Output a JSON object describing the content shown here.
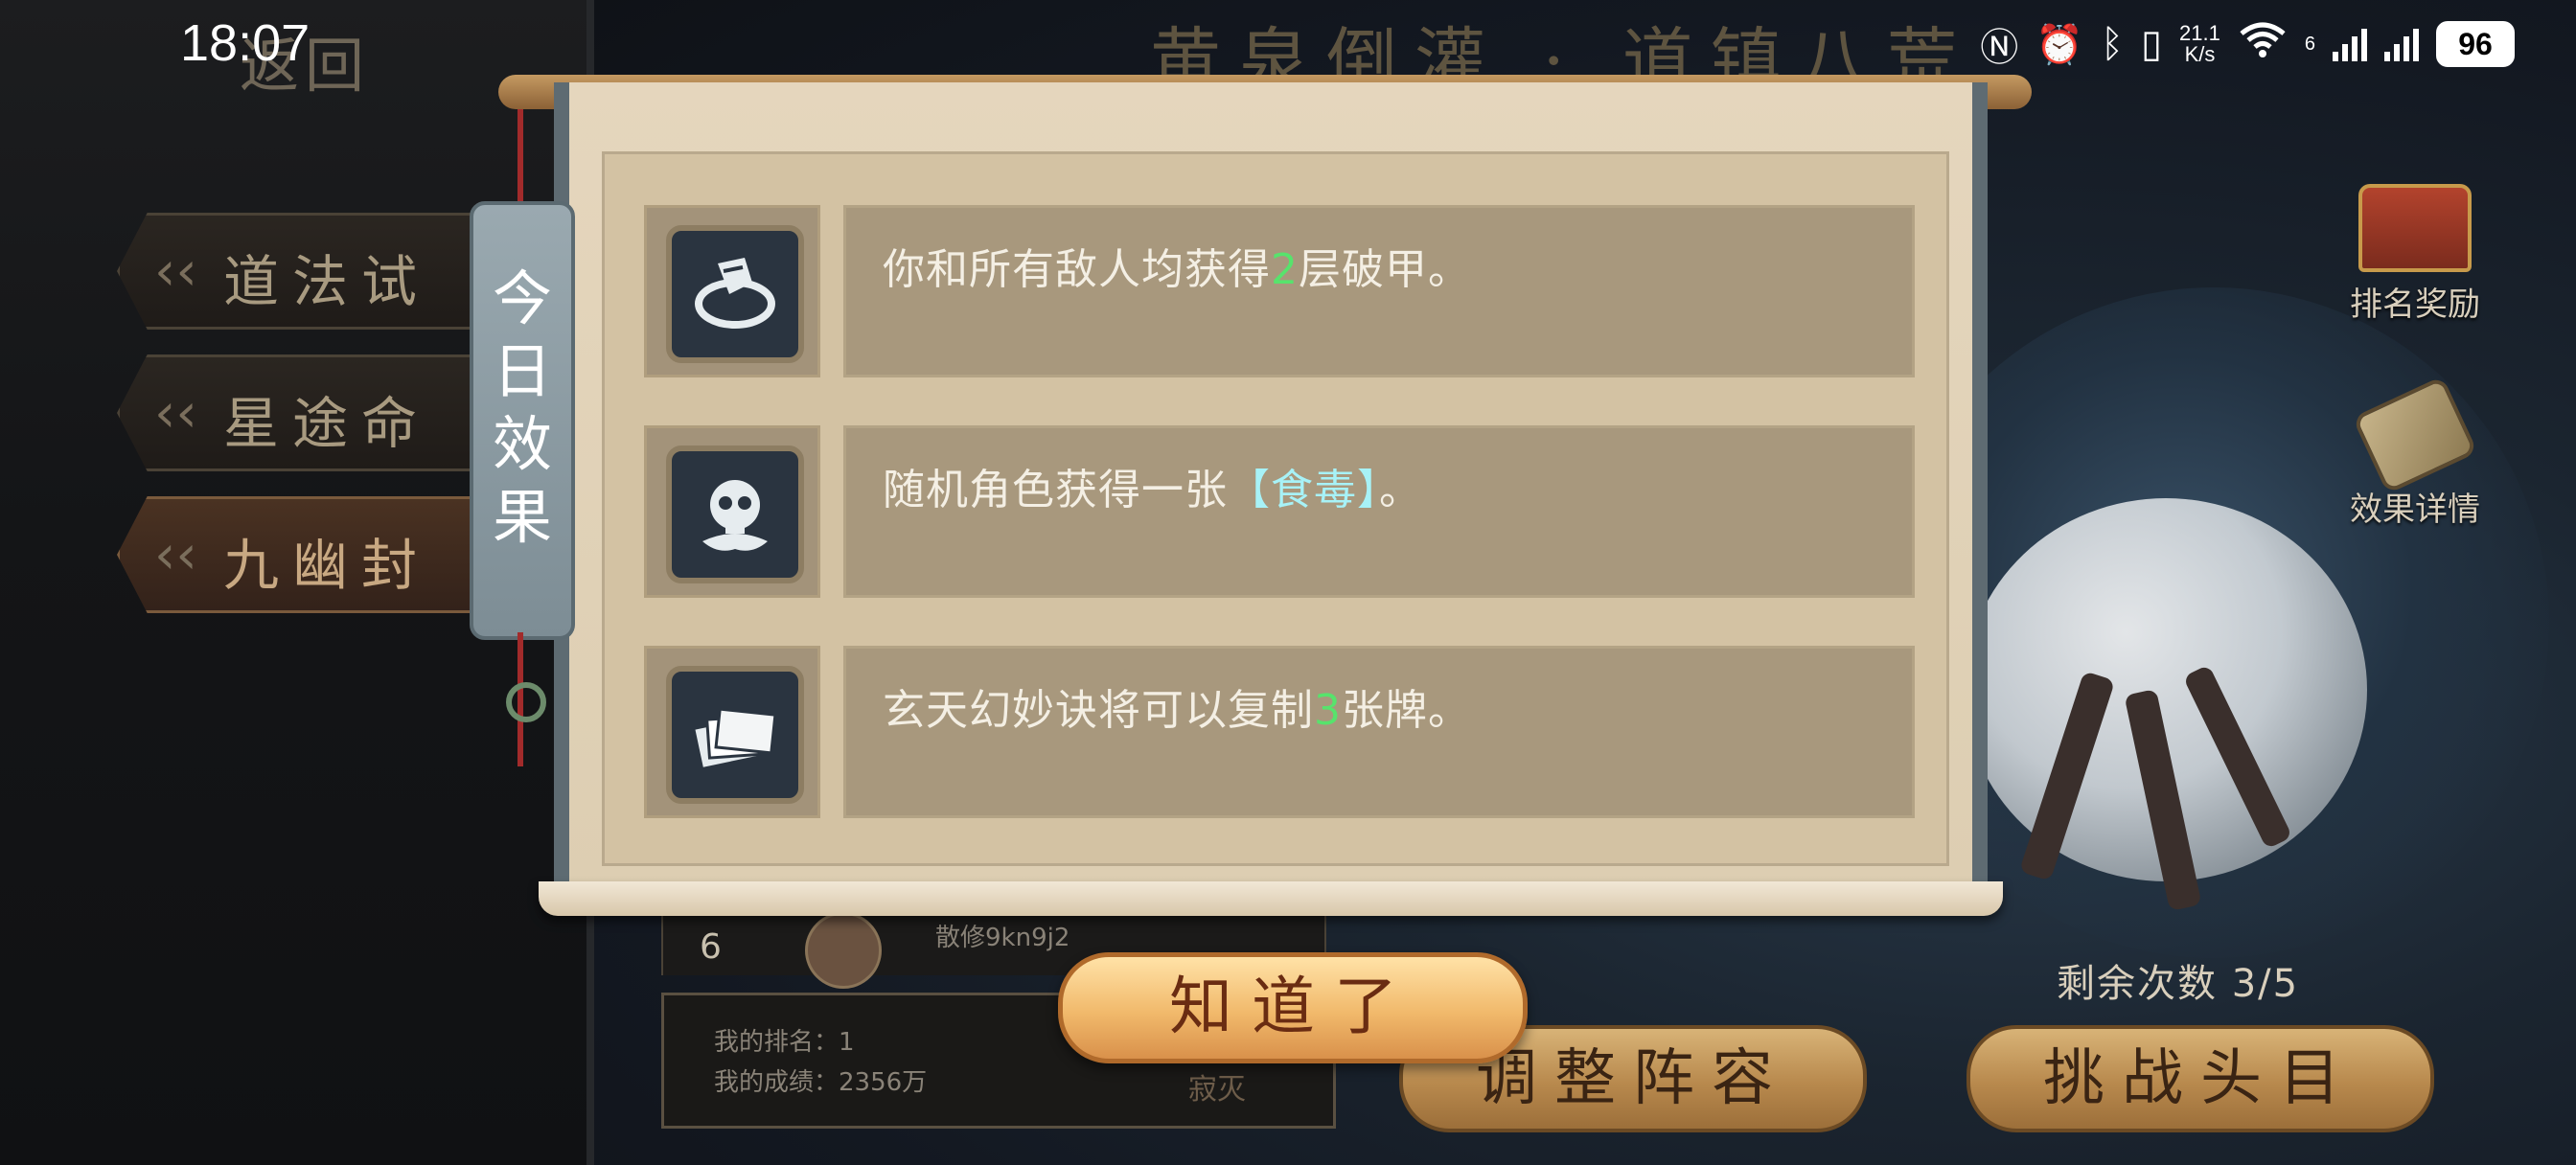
{
  "status_bar": {
    "time": "18:07",
    "net_speed_top": "21.1",
    "net_speed_bottom": "K/s",
    "wifi_badge": "6",
    "battery": "96"
  },
  "header": {
    "back_label": "返回",
    "title": "黄泉倒灌 · 道镇八荒"
  },
  "sidebar": {
    "items": [
      {
        "label": "道法试炼"
      },
      {
        "label": "星途命劫"
      },
      {
        "label": "九幽封魔"
      }
    ]
  },
  "ranking": {
    "row_rank": "6",
    "row_name": "散修9kn9j2",
    "my_rank_label": "我的排名：",
    "my_rank_value": "1",
    "my_score_label": "我的成绩：",
    "my_score_value": "2356万",
    "seal_text": "寂灭"
  },
  "right_panel": {
    "rank_reward_label": "排名奖励",
    "effect_detail_label": "效果详情",
    "remaining_label": "剩余次数",
    "remaining_value": "3/5",
    "adjust_button": "调整阵容",
    "challenge_button": "挑战头目"
  },
  "modal": {
    "ribbon_title": "今日效果",
    "effects": [
      {
        "icon": "broken-armor-icon",
        "before": "你和所有敌人均获得",
        "highlight": "2",
        "after": "层破甲。"
      },
      {
        "icon": "skull-poison-icon",
        "before": "随机角色获得一张",
        "highlight": "【食毒】",
        "after": "。"
      },
      {
        "icon": "cards-icon",
        "before": "玄天幻妙诀将可以复制",
        "highlight": "3",
        "after": "张牌。"
      }
    ],
    "confirm_button": "知道了"
  },
  "colors": {
    "highlight_green": "#57e36c",
    "highlight_cyan": "#a7f2f7",
    "ribbon": "#8c9ba2",
    "button_gold": "#f1b96b"
  }
}
